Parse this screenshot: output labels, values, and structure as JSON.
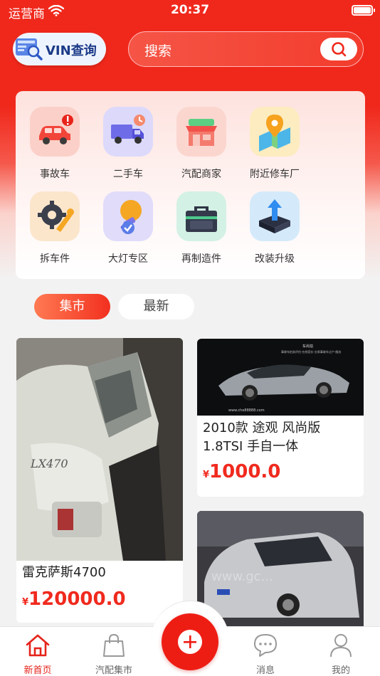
{
  "status_bar": {
    "carrier": "运营商",
    "time": "20:37"
  },
  "header": {
    "vin_button": "VIN查询",
    "search_placeholder": "搜索"
  },
  "categories": [
    {
      "label": "事故车",
      "icon": "accident-car-icon",
      "color": "#fbd0c8"
    },
    {
      "label": "二手车",
      "icon": "used-truck-icon",
      "color": "#dcd9fb"
    },
    {
      "label": "汽配商家",
      "icon": "parts-store-icon",
      "color": "#fbd6cf"
    },
    {
      "label": "附近修车厂",
      "icon": "map-pin-icon",
      "color": "#fcecc0"
    },
    {
      "label": "拆车件",
      "icon": "gear-wrench-icon",
      "color": "#fbe6cc"
    },
    {
      "label": "大灯专区",
      "icon": "bulb-icon",
      "color": "#e0dcfa"
    },
    {
      "label": "再制造件",
      "icon": "toolbox-icon",
      "color": "#d3f1e4"
    },
    {
      "label": "改装升级",
      "icon": "upgrade-icon",
      "color": "#d4eafa"
    }
  ],
  "tabs": {
    "active": "集市",
    "other": "最新"
  },
  "products": [
    {
      "title": "雷克萨斯4700",
      "currency": "¥",
      "price": "120000.0"
    },
    {
      "title_line1": "2010款 途观 风尚版",
      "title_line2": "1.8TSI 手自一体",
      "currency": "¥",
      "price": "1000.0",
      "image_caption_top": "车尚拍",
      "image_caption_sub": "事故车拍卖评估-在线竞价-交易事故车过户-服务",
      "image_caption_bottom": "www.che88888.com"
    },
    {
      "image_watermark": "www.gc..."
    }
  ],
  "tabbar": [
    {
      "label": "新首页",
      "icon": "home-icon",
      "active": true
    },
    {
      "label": "汽配集市",
      "icon": "shopping-bag-icon",
      "active": false
    },
    {
      "label": "消息",
      "icon": "chat-bubble-icon",
      "active": false
    },
    {
      "label": "我的",
      "icon": "user-icon",
      "active": false
    }
  ],
  "colors": {
    "brand_red": "#f0281c",
    "price_red": "#f02a1e"
  }
}
